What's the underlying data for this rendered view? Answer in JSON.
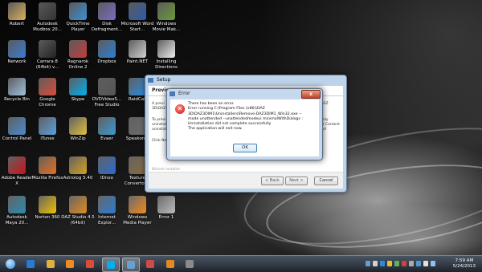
{
  "desktop_icons": [
    {
      "label": "Robert",
      "icon": "user-folder-icon",
      "color": "#d9b25a"
    },
    {
      "label": "Autodesk Mudbox 20...",
      "icon": "mudbox-icon",
      "color": "#333333"
    },
    {
      "label": "QuickTime Player",
      "icon": "quicktime-icon",
      "color": "#3a8fd6"
    },
    {
      "label": "Disk Defragment...",
      "icon": "defrag-icon",
      "color": "#7a6cc4"
    },
    {
      "label": "Microsoft Word Start...",
      "icon": "word-icon",
      "color": "#2a5caa"
    },
    {
      "label": "Windows Movie Mak...",
      "icon": "movie-maker-icon",
      "color": "#6a9a3a"
    },
    {
      "label": "Network",
      "icon": "network-icon",
      "color": "#3a7bd5"
    },
    {
      "label": "Carrara 8 (64bit) v...",
      "icon": "carrara-icon",
      "color": "#222222"
    },
    {
      "label": "Ragnarok Online 2",
      "icon": "ragnarok-icon",
      "color": "#c43a3a"
    },
    {
      "label": "Dropbox",
      "icon": "dropbox-icon",
      "color": "#2a7fd4"
    },
    {
      "label": "Paint.NET",
      "icon": "paintnet-icon",
      "color": "#d0d0d0"
    },
    {
      "label": "Installing Directions",
      "icon": "document-icon",
      "color": "#eeeeee"
    },
    {
      "label": "Recycle Bin",
      "icon": "recycle-bin-icon",
      "color": "#9fc0e0"
    },
    {
      "label": "Google Chrome",
      "icon": "chrome-icon",
      "color": "#dd4b39"
    },
    {
      "label": "Skype",
      "icon": "skype-icon",
      "color": "#00aff0"
    },
    {
      "label": "DVDVideoS... Free Studio",
      "icon": "dvdvideo-icon",
      "color": "#555555"
    },
    {
      "label": "RaidCall",
      "icon": "raidcall-icon",
      "color": "#2a8ae0"
    },
    {
      "label": "Control Panel",
      "icon": "control-panel-icon",
      "color": "#4a8ad0"
    },
    {
      "label": "iTunes",
      "icon": "itunes-icon",
      "color": "#5aa0e0"
    },
    {
      "label": "WinZip",
      "icon": "winzip-icon",
      "color": "#e0c040"
    },
    {
      "label": "Evaer",
      "icon": "evaer-icon",
      "color": "#3a9ad0"
    },
    {
      "label": "Speakonia",
      "icon": "speakonia-icon",
      "color": "#6a6a6a"
    },
    {
      "label": "Adobe Reader X",
      "icon": "adobe-reader-icon",
      "color": "#c8141a"
    },
    {
      "label": "Mozilla Firefox",
      "icon": "firefox-icon",
      "color": "#e76f1e"
    },
    {
      "label": "Astrolog 5.40",
      "icon": "astrolog-icon",
      "color": "#d4a020"
    },
    {
      "label": "IDnoo",
      "icon": "idnoo-icon",
      "color": "#2a6ad0"
    },
    {
      "label": "Texture Convertor 2",
      "icon": "texture-convertor-icon",
      "color": "#8a6a3a"
    },
    {
      "label": "Autodesk Maya 20...",
      "icon": "maya-icon",
      "color": "#2a8ab0"
    },
    {
      "label": "Norton 360",
      "icon": "norton-icon",
      "color": "#f0c000"
    },
    {
      "label": "DAZ Studio 4.5 (64bit)",
      "icon": "daz-studio-icon",
      "color": "#e08a20"
    },
    {
      "label": "Internet Explor...",
      "icon": "internet-explorer-icon",
      "color": "#2a7ad0"
    },
    {
      "label": "Windows Media Player",
      "icon": "media-player-icon",
      "color": "#f08a20"
    },
    {
      "label": "Error 1",
      "icon": "screenshot-file-icon",
      "color": "#bbbbbb"
    }
  ],
  "setup_window": {
    "title": "Setup",
    "header": "Previo",
    "partial_text_1": "A previ\n3D\\DAZ",
    "partial_text_2": "To previ\nuninstalle\nuninstall",
    "partial_text_3": "Click Ne",
    "partial_right_1": "DAZ",
    "partial_right_2": "only\nor Content\nled",
    "footer_label": "Bitrock Installer",
    "back_label": "< Back",
    "next_label": "Next >",
    "cancel_label": "Cancel"
  },
  "error_dialog": {
    "title": "Error",
    "close_label": "x",
    "lines": [
      "There has been an error.",
      "Error running C:\\Program Files (x86)\\DAZ",
      "3D\\DAZ3DIM1\\Uninstallers\\Remove-DAZ3DIM1_Win32.exe --",
      "mode unattended --unattendedmodeui minimalWithDialogs :",
      "Uninstallation did not complete successfully",
      "The application will exit now."
    ],
    "ok_label": "OK"
  },
  "taskbar": {
    "items": [
      {
        "icon": "start-orb-icon",
        "color": "#3a8ad0",
        "active": false
      },
      {
        "icon": "internet-explorer-icon",
        "color": "#2a7ad0",
        "active": false
      },
      {
        "icon": "file-explorer-icon",
        "color": "#e0b040",
        "active": false
      },
      {
        "icon": "media-player-icon",
        "color": "#f08a20",
        "active": false
      },
      {
        "icon": "chrome-icon",
        "color": "#dd4b39",
        "active": false
      },
      {
        "icon": "skype-icon",
        "color": "#00aff0",
        "active": true
      },
      {
        "icon": "picture-viewer-icon",
        "color": "#6aa0d0",
        "active": true
      },
      {
        "icon": "paint-icon",
        "color": "#d04a4a",
        "active": false
      },
      {
        "icon": "daz-studio-icon",
        "color": "#e08a20",
        "active": false
      },
      {
        "icon": "screenshot-tool-icon",
        "color": "#8a8a8a",
        "active": false
      }
    ],
    "clock_time": "7:59 AM",
    "clock_date": "5/24/2013"
  },
  "colors": {
    "error_title_bar": "#c5d8ee",
    "close_button": "#c5401f",
    "taskbar": "#1d232b"
  }
}
